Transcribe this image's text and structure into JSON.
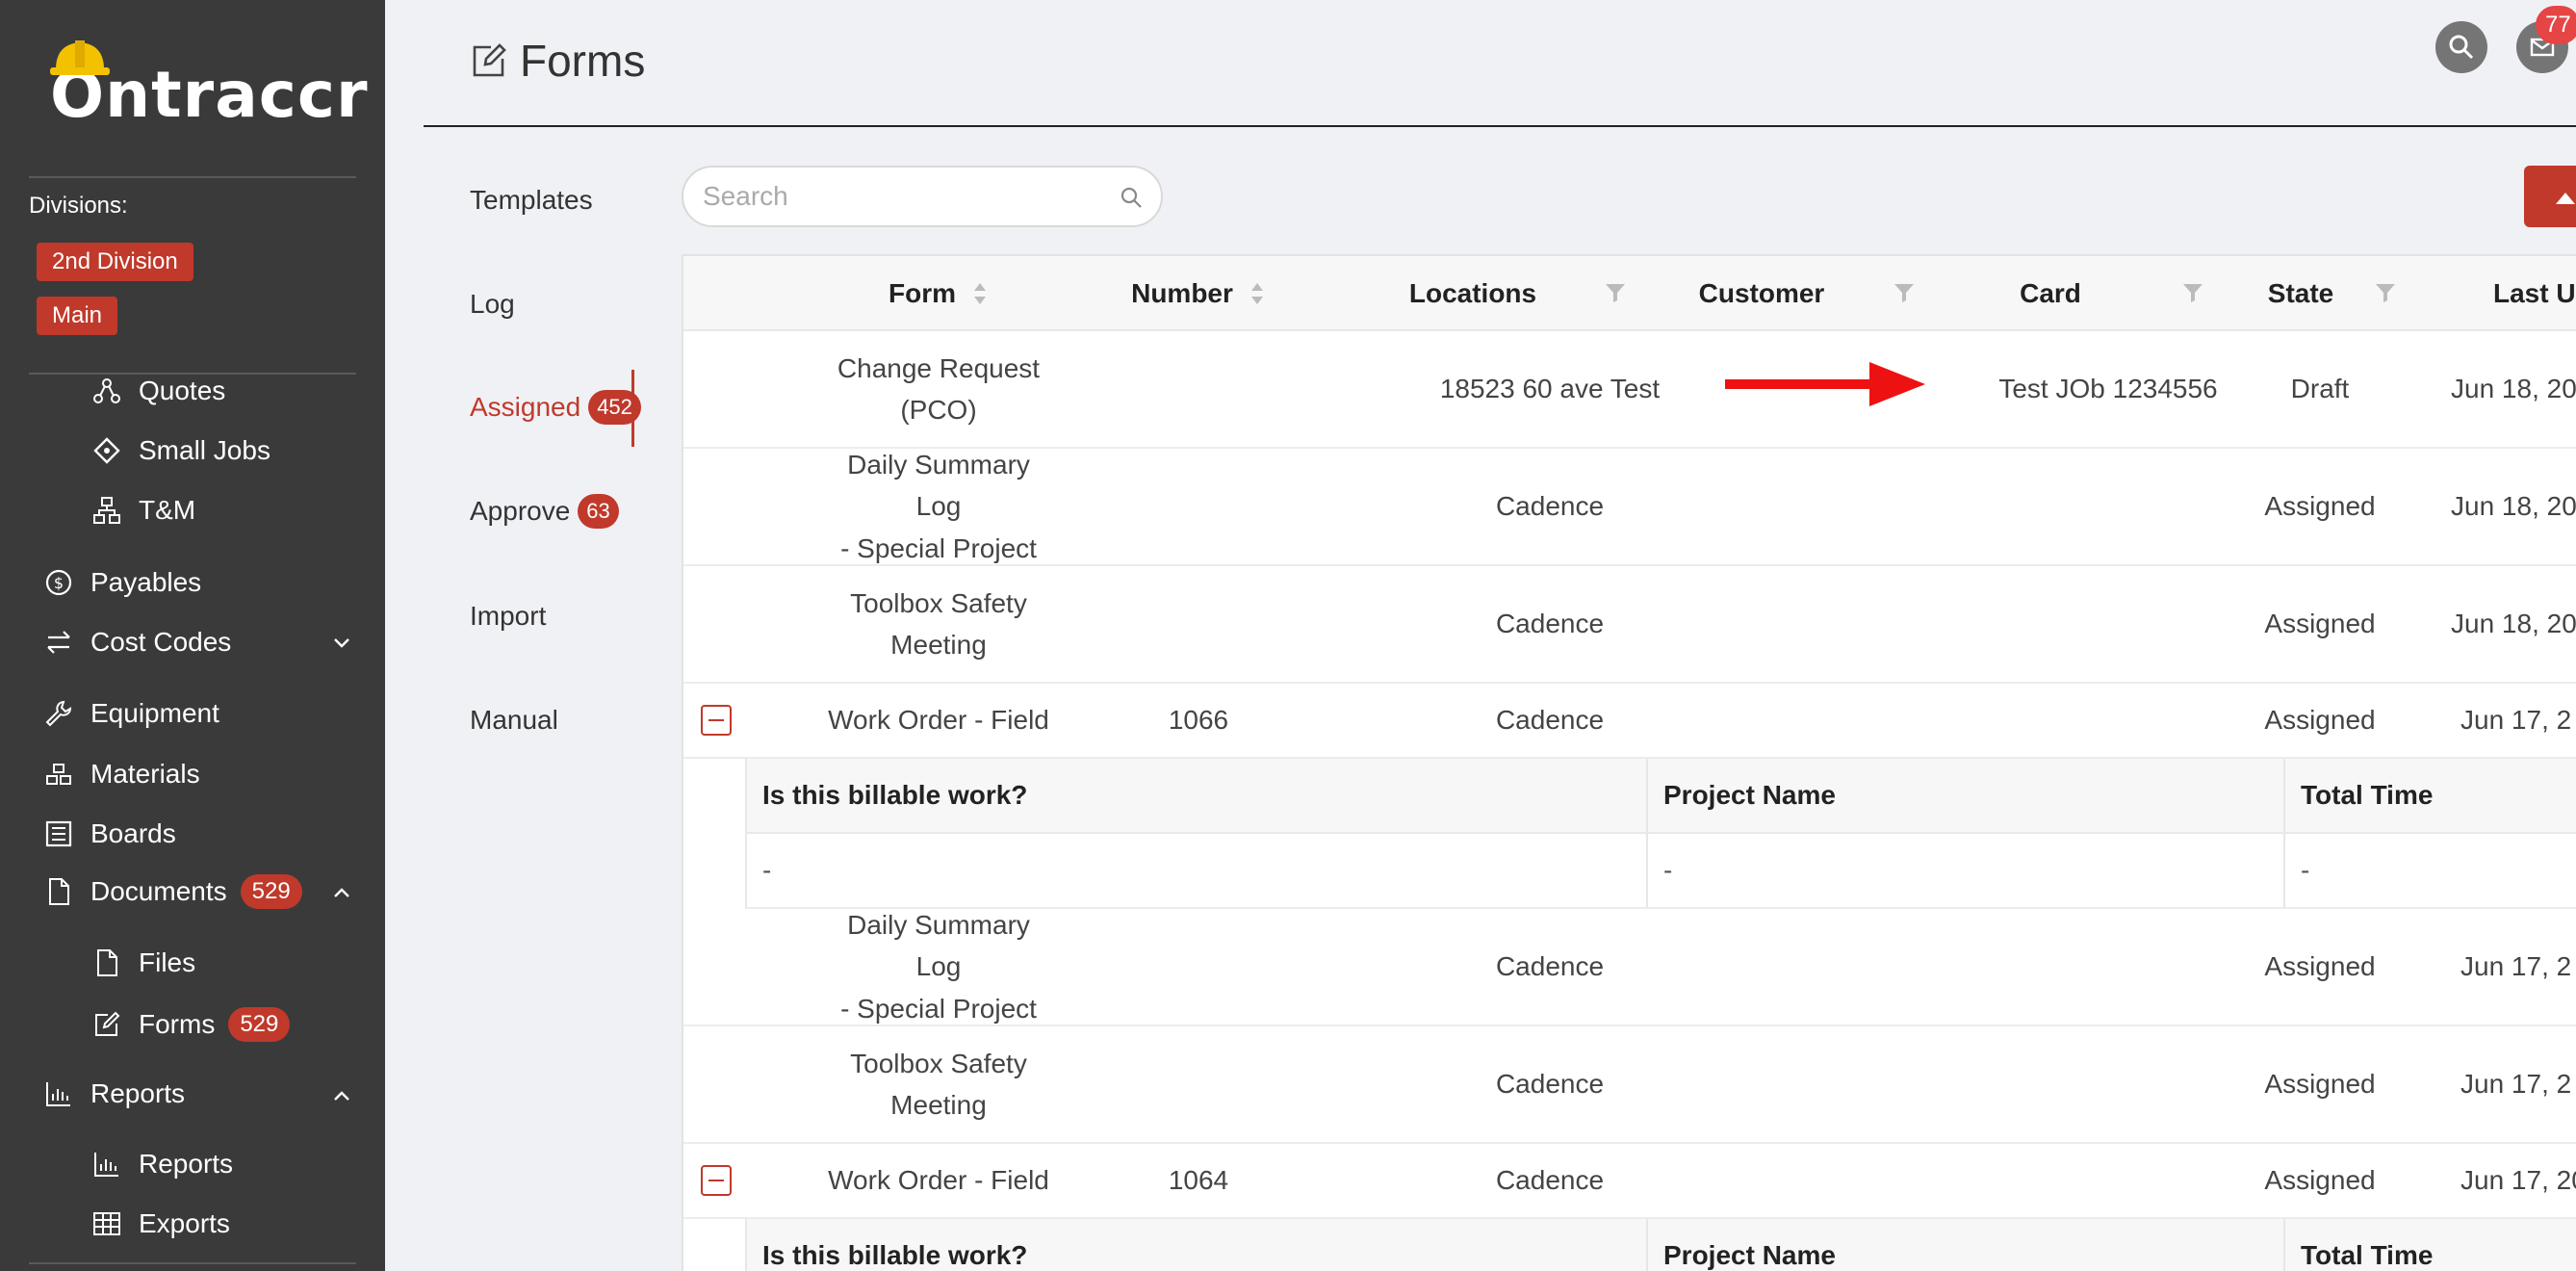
{
  "sidebar": {
    "brand": "Ontraccr",
    "divisions_label": "Divisions:",
    "divisions": [
      "2nd Division",
      "Main"
    ],
    "items": [
      {
        "label": "Quotes",
        "icon": "quotes-icon"
      },
      {
        "label": "Small Jobs",
        "icon": "small-jobs-icon"
      },
      {
        "label": "T&M",
        "icon": "tm-icon"
      },
      {
        "label": "Payables",
        "icon": "dollar-icon"
      },
      {
        "label": "Cost Codes",
        "icon": "cost-codes-icon"
      },
      {
        "label": "Equipment",
        "icon": "wrench-icon"
      },
      {
        "label": "Materials",
        "icon": "materials-icon"
      },
      {
        "label": "Boards",
        "icon": "boards-icon"
      },
      {
        "label": "Documents",
        "icon": "file-icon",
        "badge": "529"
      },
      {
        "label": "Files",
        "icon": "file-icon"
      },
      {
        "label": "Forms",
        "icon": "edit-icon",
        "badge": "529"
      },
      {
        "label": "Reports",
        "icon": "chart-icon"
      },
      {
        "label": "Reports",
        "icon": "chart-icon"
      },
      {
        "label": "Exports",
        "icon": "table-icon"
      }
    ]
  },
  "header": {
    "title": "Forms",
    "mail_badge": "77"
  },
  "subnav": [
    {
      "label": "Templates"
    },
    {
      "label": "Log"
    },
    {
      "label": "Assigned",
      "badge": "452"
    },
    {
      "label": "Approve",
      "badge": "63"
    },
    {
      "label": "Import"
    },
    {
      "label": "Manual"
    }
  ],
  "search": {
    "placeholder": "Search",
    "value": ""
  },
  "table": {
    "columns": [
      "Form",
      "Number",
      "Locations",
      "Customer",
      "Card",
      "State",
      "Last U"
    ],
    "rows": [
      {
        "form_line1": "Change Request",
        "form_line2": "(PCO)",
        "number": "",
        "location": "18523 60 ave Test",
        "customer": "",
        "card": "Test JOb 1234556",
        "state": "Draft",
        "date": "Jun 18, 20"
      },
      {
        "form_line1": "Daily Summary Log",
        "form_line2": "- Special Project",
        "number": "",
        "location": "Cadence",
        "customer": "",
        "card": "",
        "state": "Assigned",
        "date": "Jun 18, 20"
      },
      {
        "form_line1": "Toolbox Safety",
        "form_line2": "Meeting",
        "number": "",
        "location": "Cadence",
        "customer": "",
        "card": "",
        "state": "Assigned",
        "date": "Jun 18, 20"
      },
      {
        "form_line1": "Work Order - Field",
        "form_line2": "",
        "number": "1066",
        "location": "Cadence",
        "customer": "",
        "card": "",
        "state": "Assigned",
        "date": "Jun 17, 2"
      },
      {
        "form_line1": "Daily Summary Log",
        "form_line2": "- Special Project",
        "number": "",
        "location": "Cadence",
        "customer": "",
        "card": "",
        "state": "Assigned",
        "date": "Jun 17, 2"
      },
      {
        "form_line1": "Toolbox Safety",
        "form_line2": "Meeting",
        "number": "",
        "location": "Cadence",
        "customer": "",
        "card": "",
        "state": "Assigned",
        "date": "Jun 17, 2"
      },
      {
        "form_line1": "Work Order - Field",
        "form_line2": "",
        "number": "1064",
        "location": "Cadence",
        "customer": "",
        "card": "",
        "state": "Assigned",
        "date": "Jun 17, 20"
      }
    ],
    "sub_columns": [
      "Is this billable work?",
      "Project Name",
      "Total Time"
    ],
    "sub_values": [
      "-",
      "-",
      "-"
    ]
  },
  "colors": {
    "accent": "#c0392b",
    "sidebar": "#3a3a3a",
    "arrow": "#ee1111"
  }
}
